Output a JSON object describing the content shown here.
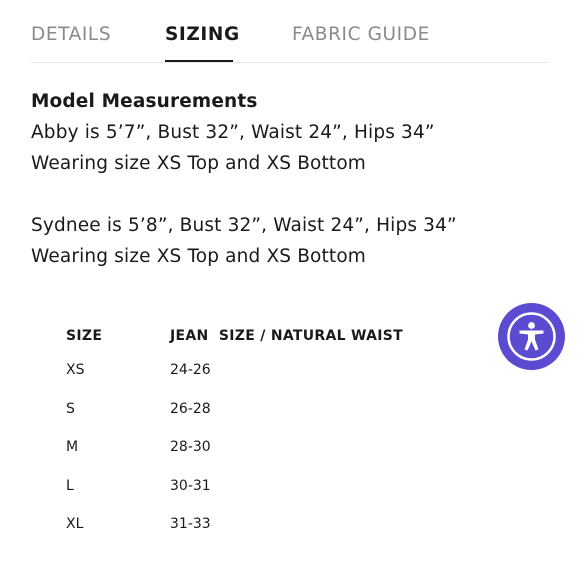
{
  "tabs": [
    {
      "label": "DETAILS",
      "active": false
    },
    {
      "label": "SIZING",
      "active": true
    },
    {
      "label": "FABRIC GUIDE",
      "active": false
    }
  ],
  "measurements": {
    "heading": "Model Measurements",
    "models": [
      {
        "stats": "Abby is 5’7”, Bust 32”, Waist 24”, Hips 34”",
        "wearing": "Wearing size XS Top and XS Bottom"
      },
      {
        "stats": "Sydnee is 5’8”, Bust 32”, Waist 24”, Hips 34”",
        "wearing": "Wearing size XS Top and XS Bottom"
      }
    ]
  },
  "size_table": {
    "headers": [
      "SIZE",
      "JEAN  SIZE / NATURAL WAIST"
    ],
    "rows": [
      [
        "XS",
        "24-26"
      ],
      [
        "S",
        "26-28"
      ],
      [
        "M",
        "28-30"
      ],
      [
        "L",
        "30-31"
      ],
      [
        "XL",
        "31-33"
      ]
    ]
  },
  "accessibility": {
    "icon": "accessibility-icon",
    "color": "#5b4bd1"
  },
  "colors": {
    "active_tab": "#1a1a1a",
    "inactive_tab": "#8a8a8a",
    "divider": "#e6e6e6"
  }
}
